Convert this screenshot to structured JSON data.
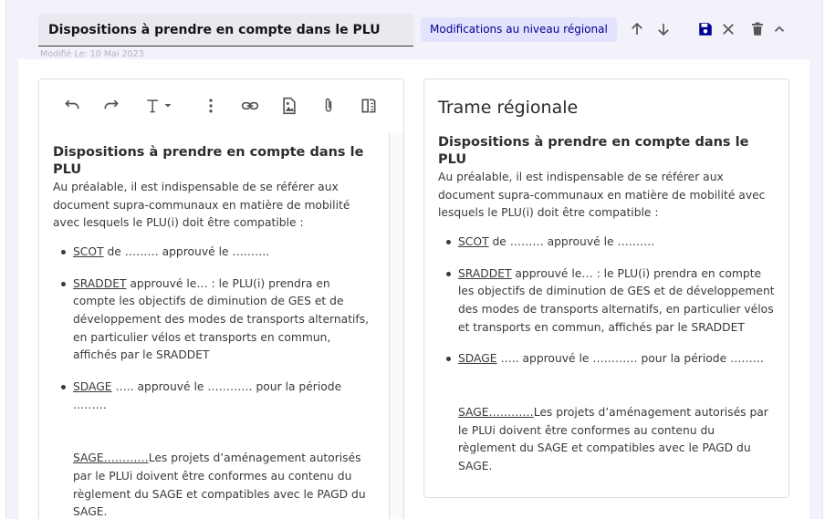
{
  "header": {
    "title_value": "Dispositions à prendre en compte dans le PLU",
    "modified": "Modifié Le: 10 Mai 2023",
    "region_badge": "Modifications au niveau régional"
  },
  "icons": {
    "move_up": "arrow-up-icon",
    "move_down": "arrow-down-icon",
    "save": "save-icon",
    "close": "close-icon",
    "delete": "trash-icon",
    "collapse": "chevron-up-icon",
    "undo": "undo-icon",
    "redo": "redo-icon",
    "text_format": "text-format-icon",
    "more": "more-vertical-icon",
    "link": "link-icon",
    "image": "image-file-icon",
    "attach": "paperclip-icon",
    "compare": "compare-icon"
  },
  "colors": {
    "accent": "#000091",
    "badge_bg": "#e3e3fd",
    "panel_bg": "#f3f2fb",
    "icon_grey": "#666666"
  },
  "content": {
    "heading": "Dispositions à prendre en compte dans le PLU",
    "intro": "Au préalable, il est indispensable de se référer aux document supra-communaux en matière de mobilité avec lesquels le PLU(i) doit être compatible :",
    "items": [
      {
        "link": "SCOT",
        "text": " de ……… approuvé le ………."
      },
      {
        "link": "SRADDET",
        "text": " approuvé le… : le PLU(i) prendra en compte les objectifs de diminution de GES et de développement des modes de transports alternatifs, en particulier vélos et transports en commun, affichés par le SRADDET"
      },
      {
        "link": "SDAGE",
        "text": " ….. approuvé le ………… pour la période ………"
      }
    ],
    "sage_link": "SAGE…………",
    "sage_text": "Les projets d’aménagement autorisés par le PLUi doivent être conformes au contenu du règlement du SAGE et compatibles avec le PAGD du SAGE."
  },
  "preview": {
    "title": "Trame régionale"
  }
}
